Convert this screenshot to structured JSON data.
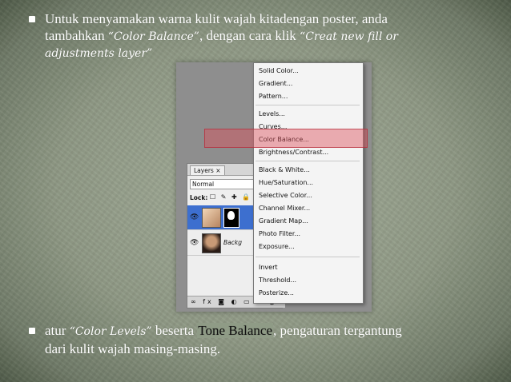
{
  "slide": {
    "bullet1": {
      "line1": "Untuk menyamakan warna kulit wajah kitadengan poster, anda",
      "line2_a": "tambahkan ",
      "line2_b": "“Color Balance”",
      "line2_c": ", dengan cara klik ",
      "line2_d": "“Creat new fill or",
      "line3": "adjustments layer”"
    },
    "bullet2": {
      "a": "atur ",
      "b": "“Color Levels”",
      "c": " beserta ",
      "d": "Tone Balance",
      "e": ", pengaturan tergantung",
      "line2": "dari kulit wajah masing-masing."
    }
  },
  "layers_panel": {
    "tab": "Layers ×",
    "blend_mode": "Normal",
    "lock_label": "Lock:",
    "lock_icons": "☐ ✎ ✚ 🔒",
    "layer2_name": "Backg",
    "footer_icons": "∞ fx ◙ ◐ ▭ ▫ 🗑"
  },
  "adjustment_menu": {
    "items": [
      "Solid Color...",
      "Gradient...",
      "Pattern...",
      "Levels...",
      "Curves...",
      "Color Balance...",
      "Brightness/Contrast...",
      "Black & White...",
      "Hue/Saturation...",
      "Selective Color...",
      "Channel Mixer...",
      "Gradient Map...",
      "Photo Filter...",
      "Exposure...",
      "Invert",
      "Threshold...",
      "Posterize..."
    ],
    "highlighted_item": "Color Balance..."
  },
  "colors": {
    "highlight": "#dc505a",
    "selected_layer": "#3d6fcf"
  }
}
